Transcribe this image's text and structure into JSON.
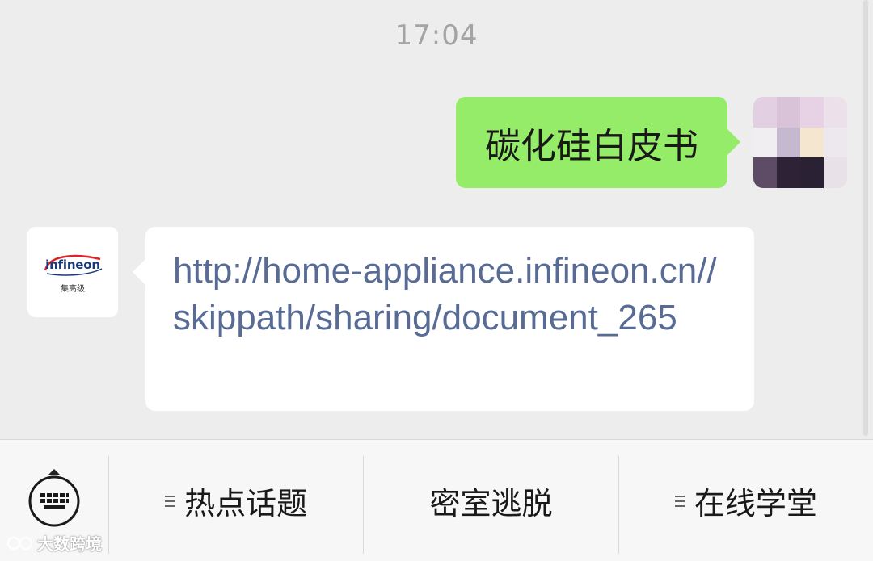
{
  "chat": {
    "timestamp": "17:04",
    "outgoing_message": "碳化硅白皮书",
    "incoming_avatar": {
      "brand_name": "infineon",
      "brand_sub": "集高级"
    },
    "incoming_message": "http://home-appliance.infineon.cn//skippath/sharing/document_265"
  },
  "menu": {
    "keyboard_icon": "keyboard-icon",
    "items": [
      {
        "label": "热点话题",
        "has_submenu": true
      },
      {
        "label": "密室逃脱",
        "has_submenu": false
      },
      {
        "label": "在线学堂",
        "has_submenu": true
      }
    ]
  },
  "watermark": {
    "text": "大数跨境"
  },
  "colors": {
    "background": "#ededed",
    "outgoing_bubble": "#95ec69",
    "incoming_bubble": "#ffffff",
    "link": "#576b95",
    "timestamp": "#a4a4a4",
    "menu_bar": "#f7f7f7"
  }
}
